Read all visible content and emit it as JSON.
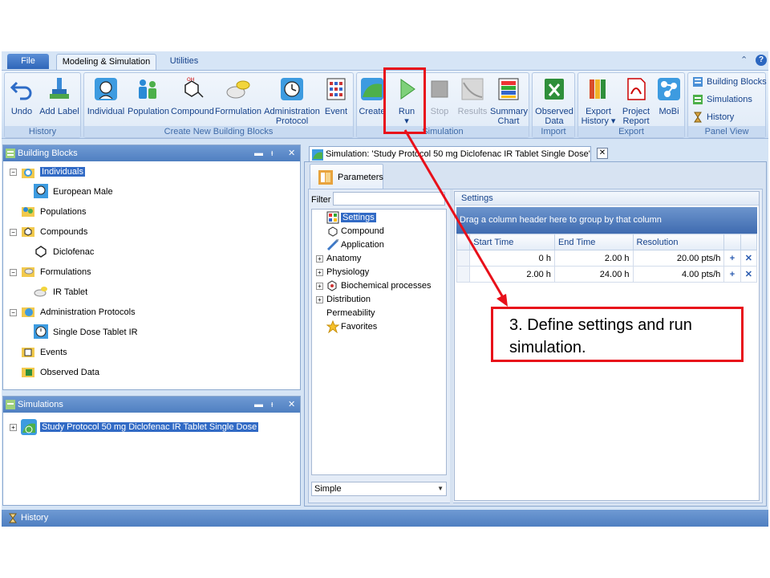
{
  "ribbon": {
    "tabs": [
      {
        "label": "File"
      },
      {
        "label": "Modeling & Simulation"
      },
      {
        "label": "Utilities"
      }
    ],
    "groups": {
      "history": {
        "label": "History",
        "undo": "Undo",
        "add_label": "Add Label"
      },
      "create": {
        "label": "Create New Building Blocks",
        "individual": "Individual",
        "population": "Population",
        "compound": "Compound",
        "formulation": "Formulation",
        "admin_line1": "Administration",
        "admin_line2": "Protocol",
        "event": "Event"
      },
      "simulation": {
        "label": "Simulation",
        "create": "Create",
        "run": "Run",
        "run_arrow": "▾",
        "stop": "Stop",
        "results": "Results",
        "summary_line1": "Summary",
        "summary_line2": "Chart"
      },
      "import": {
        "label": "Import",
        "observed_line1": "Observed",
        "observed_line2": "Data"
      },
      "export": {
        "label": "Export",
        "export_line1": "Export",
        "export_line2": "History ▾",
        "project_line1": "Project",
        "project_line2": "Report",
        "mobi": "MoBi"
      },
      "panel_view": {
        "label": "Panel View",
        "building_blocks": "Building Blocks",
        "simulations": "Simulations",
        "history": "History"
      }
    }
  },
  "building_blocks_panel": {
    "title": "Building Blocks",
    "controls": [
      "▬",
      "ᵻ",
      "✕"
    ],
    "items": [
      {
        "label": "Individuals"
      },
      {
        "label": "European Male"
      },
      {
        "label": "Populations"
      },
      {
        "label": "Compounds"
      },
      {
        "label": "Diclofenac"
      },
      {
        "label": "Formulations"
      },
      {
        "label": "IR Tablet"
      },
      {
        "label": "Administration Protocols"
      },
      {
        "label": "Single Dose Tablet IR"
      },
      {
        "label": "Events"
      },
      {
        "label": "Observed Data"
      }
    ]
  },
  "simulations_panel": {
    "title": "Simulations",
    "controls": [
      "▬",
      "ᵻ",
      "✕"
    ],
    "items": [
      {
        "label": "Study Protocol 50 mg Diclofenac IR Tablet Single Dose"
      }
    ]
  },
  "document_tab": {
    "title": "Simulation: 'Study Protocol 50 mg Diclofenac IR Tablet Single Dose'",
    "close": "✕"
  },
  "parameters": {
    "tab_label": "Parameters",
    "filter_label": "Filter",
    "filter_value": "",
    "tree": [
      {
        "label": "Settings"
      },
      {
        "label": "Compound"
      },
      {
        "label": "Application"
      },
      {
        "label": "Anatomy"
      },
      {
        "label": "Physiology"
      },
      {
        "label": "Biochemical processes"
      },
      {
        "label": "Distribution"
      },
      {
        "label": "Permeability"
      },
      {
        "label": "Favorites"
      }
    ],
    "mode": "Simple"
  },
  "settings": {
    "title": "Settings",
    "group_hint": "Drag a column header here to group by that column",
    "columns": [
      "Start Time",
      "End Time",
      "Resolution"
    ],
    "rows": [
      {
        "start": "0 h",
        "end": "2.00 h",
        "resolution": "20.00 pts/h",
        "add": "+",
        "remove": "✕"
      },
      {
        "start": "2.00 h",
        "end": "24.00 h",
        "resolution": "4.00 pts/h",
        "add": "+",
        "remove": "✕"
      }
    ]
  },
  "bottom_panel": {
    "title": "History"
  },
  "annotation": {
    "line1": "3. Define settings and run",
    "line2": "simulation.",
    "color": "#e8101a"
  }
}
